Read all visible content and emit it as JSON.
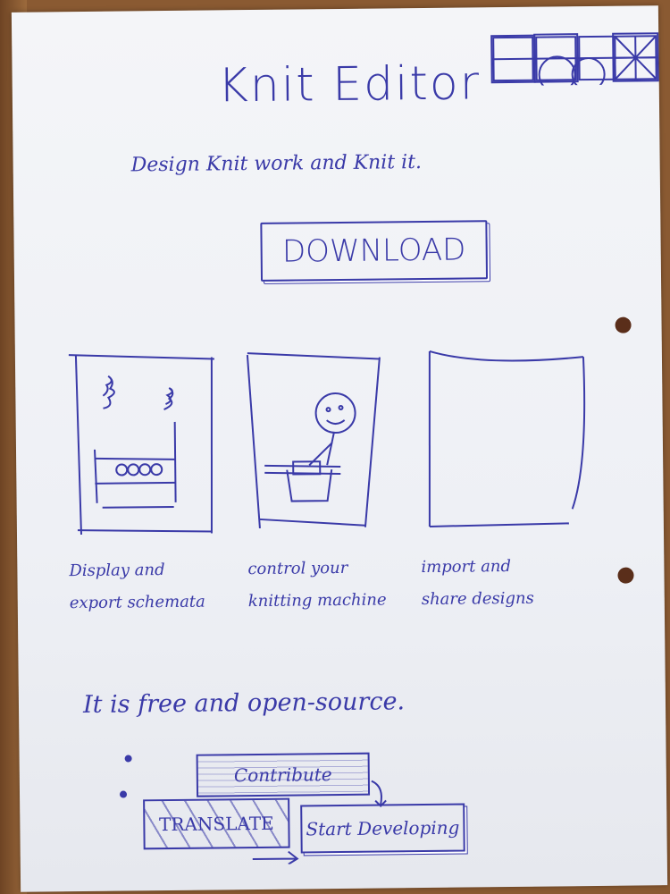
{
  "sketch": {
    "title": "Knit Editor",
    "tagline": "Design Knit work and Knit it.",
    "download_label": "DOWNLOAD",
    "features": [
      {
        "caption_line1": "Display and",
        "caption_line2": "export schemata",
        "illustration": "knitting-pattern-icon"
      },
      {
        "caption_line1": "control your",
        "caption_line2": "knitting machine",
        "illustration": "person-at-machine-icon"
      },
      {
        "caption_line1": "import and",
        "caption_line2": "share designs",
        "illustration": "empty-frame"
      }
    ],
    "free_text": "It is free and open-source.",
    "contribute_label": "Contribute",
    "translate_label": "TRANSLATE",
    "develop_label": "Start Developing"
  },
  "colors": {
    "ink": "#3a3aa8",
    "paper": "#f1f2f6",
    "desk": "#8a5a32"
  }
}
